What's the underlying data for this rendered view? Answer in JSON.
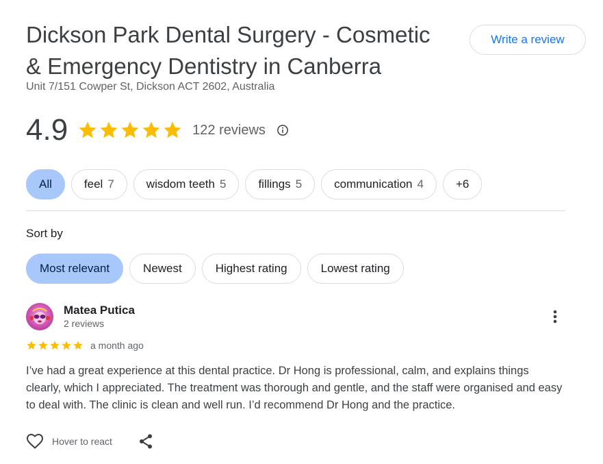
{
  "place": {
    "title_line1": "Dickson Park Dental Surgery - Cosmetic",
    "title_line2": "& Emergency Dentistry in Canberra",
    "address": "Unit 7/151 Cowper St, Dickson ACT 2602, Australia",
    "write_review_label": "Write a review"
  },
  "rating": {
    "value": "4.9",
    "stars": 5,
    "reviews_label": "122 reviews",
    "star_color": "#fbbc04"
  },
  "filters": {
    "chips": [
      {
        "label": "All",
        "count": "",
        "active": true
      },
      {
        "label": "feel",
        "count": "7"
      },
      {
        "label": "wisdom teeth",
        "count": "5"
      },
      {
        "label": "fillings",
        "count": "5"
      },
      {
        "label": "communication",
        "count": "4"
      },
      {
        "label": "+6",
        "count": ""
      }
    ]
  },
  "sort": {
    "label": "Sort by",
    "options": [
      {
        "label": "Most relevant",
        "active": true
      },
      {
        "label": "Newest"
      },
      {
        "label": "Highest rating"
      },
      {
        "label": "Lowest rating"
      }
    ]
  },
  "review": {
    "author": "Matea Putica",
    "author_meta": "2 reviews",
    "stars": 5,
    "date": "a month ago",
    "text": "I’ve had a great experience at this dental practice. Dr Hong is professional, calm, and explains things clearly, which I appreciated. The treatment was thorough and gentle, and the staff were organised and easy to deal with. The clinic is clean and well run. I’d recommend Dr Hong and the practice.",
    "react_label": "Hover to react"
  },
  "colors": {
    "accent": "#1a73e8",
    "active_chip": "#a8c7fa"
  },
  "icons": {
    "star": "star-icon",
    "info": "info-icon",
    "more": "more-vert-icon",
    "heart": "heart-outline-icon",
    "share": "share-icon"
  }
}
